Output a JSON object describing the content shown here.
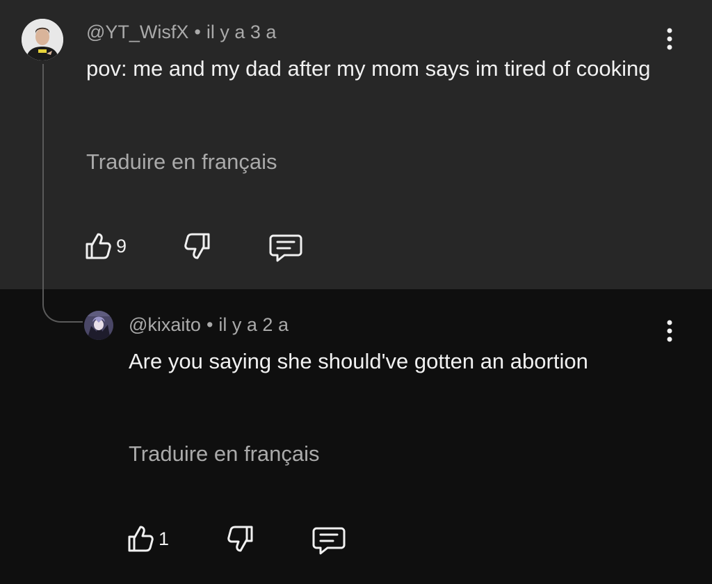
{
  "comment": {
    "author": "@YT_WisfX",
    "separator": "•",
    "time": "il y a 3 a",
    "text": "pov: me and my dad after my mom says im tired of cooking",
    "translate_label": "Traduire en français",
    "likes": "9",
    "avatar_icon": "user-avatar-photo"
  },
  "reply": {
    "author": "@kixaito",
    "separator": "•",
    "time": "il y a 2 a",
    "text": "Are you saying she should've gotten an abortion",
    "translate_label": "Traduire en français",
    "likes": "1",
    "avatar_icon": "user-avatar-anime"
  },
  "icons": {
    "like": "thumbs-up-icon",
    "dislike": "thumbs-down-icon",
    "reply": "reply-comment-icon",
    "menu": "more-vert-icon"
  },
  "colors": {
    "top_bg": "#272727",
    "bottom_bg": "#0f0f0f",
    "primary_text": "#f1f1f1",
    "secondary_text": "#aaaaaa"
  }
}
